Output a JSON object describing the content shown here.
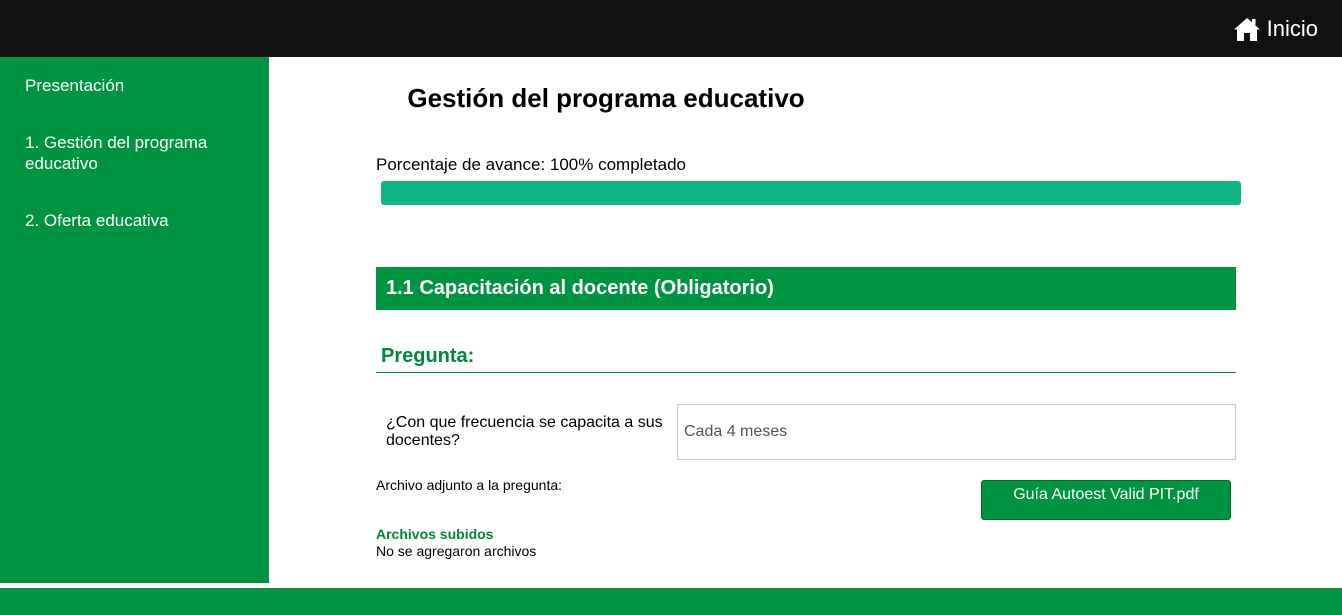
{
  "header": {
    "home_label": "Inicio",
    "home_icon": "home-icon"
  },
  "sidebar": {
    "items": [
      {
        "label": "Presentación"
      },
      {
        "label": "1. Gestión del programa educativo"
      },
      {
        "label": "2. Oferta educativa"
      }
    ]
  },
  "main": {
    "title": "Gestión del programa educativo",
    "progress": {
      "label": "Porcentaje de avance: 100% completado",
      "percent": 100,
      "color": "#12b385"
    },
    "section_title": "1.1 Capacitación al docente (Obligatorio)",
    "question_heading": "Pregunta:",
    "question_text": "¿Con que frecuencia se capacita a sus docentes?",
    "answer_value": "Cada 4 meses",
    "attachment_label": "Archivo adjunto a la pregunta:",
    "attachment_button": "Guía Autoest Valid PIT.pdf",
    "uploads_title": "Archivos subidos",
    "uploads_empty": "No se agregaron archivos"
  },
  "colors": {
    "brand_green": "#009440",
    "topbar": "#111111",
    "progress": "#12b385"
  }
}
